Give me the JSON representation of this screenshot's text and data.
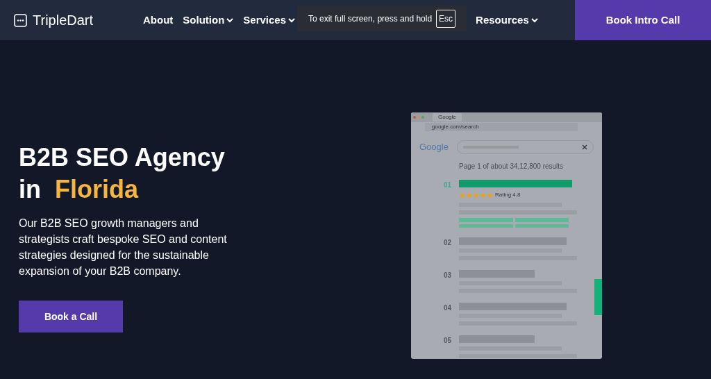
{
  "nav": {
    "logo": "TripleDart",
    "items": [
      {
        "label": "About",
        "dropdown": false
      },
      {
        "label": "Solution",
        "dropdown": true
      },
      {
        "label": "Services",
        "dropdown": true
      },
      {
        "label": "Resources",
        "dropdown": true
      }
    ],
    "cta": "Book Intro Call"
  },
  "toast": {
    "text": "To exit full screen, press and hold",
    "key": "Esc"
  },
  "hero": {
    "title_line1": "B2B SEO Agency",
    "title_prefix": "in",
    "title_highlight": "Florida",
    "description": "Our B2B SEO growth managers and strategists craft bespoke SEO and content strategies designed for the sustainable expansion of your B2B company.",
    "button": "Book a Call"
  },
  "mockup": {
    "tab": "Google",
    "address": "google.com/search",
    "logo": "Google",
    "results_count": "Page 1 of about 34,12,800 results",
    "rating": "Rating 4.8",
    "stars": 5,
    "results": [
      {
        "number": "01",
        "highlighted": true
      },
      {
        "number": "02",
        "highlighted": false
      },
      {
        "number": "03",
        "highlighted": false
      },
      {
        "number": "04",
        "highlighted": false
      },
      {
        "number": "05",
        "highlighted": false
      }
    ]
  }
}
